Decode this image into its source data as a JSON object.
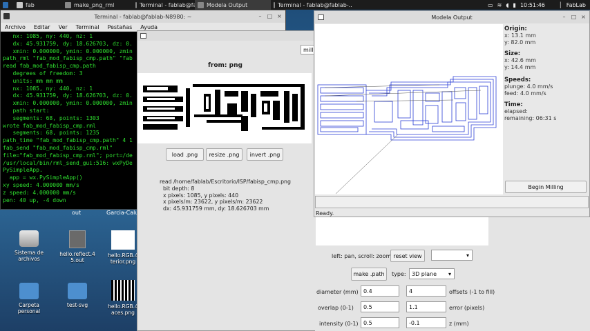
{
  "taskbar": {
    "tasks": [
      "fab",
      "make_png_rml",
      "Terminal - fablab@fabl...",
      "Modela Output",
      "Terminal - fablab@fablab-..."
    ],
    "time": "10:51:46",
    "user": "FabLab"
  },
  "terminal": {
    "title": "Terminal - fablab@fablab-N8980: ~",
    "menu": [
      "Archivo",
      "Editar",
      "Ver",
      "Terminal",
      "Pestañas",
      "Ayuda"
    ],
    "lines": [
      "   nx: 1085, ny: 440, nz: 1",
      "   dx: 45.931759, dy: 18.626703, dz: 0.",
      "   xmin: 0.000000, ymin: 0.000000, zmin",
      "path_rml \"fab_mod_fabisp_cmp.path\" \"fab",
      "read fab_mod_fabisp_cmp.path",
      "   degrees of freedom: 3",
      "   units: mm mm mm",
      "   nx: 1085, ny: 440, nz: 1",
      "   dx: 45.931759, dy: 18.626703, dz: 0.",
      "   xmin: 0.000000, ymin: 0.000000, zmin",
      "   path start:",
      "   segments: 68, points: 1303",
      "wrote fab_mod_fabisp_cmp.rml",
      "   segments: 68, points: 1235",
      "path_time \"fab_mod_fabisp_cmp.path\" 4 1",
      "fab_send \"fab_mod_fabisp_cmp.rml\"",
      "file=\"fab_mod_fabisp_cmp.rml\"; port=/de",
      "/usr/local/bin/rml_send_gui:516: wxPyDe",
      "PySimpleApp.",
      "  app = wx.PySimpleApp()",
      "xy speed: 4.000000 mm/s",
      "z speed: 4.000000 mm/s",
      "pen: 40 up, -4 down"
    ]
  },
  "desktop": {
    "icons": [
      {
        "label": "Sistema de archivos"
      },
      {
        "label": "hello.reflect.4 5.out"
      },
      {
        "label": "hello.RGB.4 terior.png"
      },
      {
        "label": "Carpeta personal"
      },
      {
        "label": "test-svg"
      },
      {
        "label": "hello.RGB.4 aces.png"
      }
    ],
    "partial_labels": [
      "out",
      "Garcia-Calu"
    ]
  },
  "rml": {
    "from_label": "from: png",
    "mill_partial": "mill t",
    "buttons": {
      "load": "load .png",
      "resize": "resize .png",
      "invert": "invert .png"
    },
    "info": [
      "read /home/fablab/Escritorio/ISP/fabisp_cmp.png",
      "  bit depth: 8",
      "  x pixels: 1085, y pixels: 440",
      "  x pixels/m: 23622, y pixels/m: 23622",
      "  dx: 45.931759 mm, dy: 18.626703 mm"
    ],
    "pan_hint": "left: pan, scroll: zoom",
    "reset_view": "reset view",
    "make_path": "make .path",
    "type_label": "type:",
    "type_value": "3D plane",
    "diameter_label": "diameter (mm)",
    "diameter_value": "0.4",
    "offsets_value": "4",
    "offsets_label": "offsets (-1 to fill)",
    "overlap_label": "overlap (0-1)",
    "overlap_value": "0.5",
    "error_value": "1.1",
    "error_label": "error (pixels)",
    "intensity_label": "intensity (0-1)",
    "intensity_value": "0.5",
    "z_value": "-0.1",
    "z_label": "z (mm)"
  },
  "modela": {
    "title": "Modela Output",
    "origin_title": "Origin:",
    "origin_x": "x: 13.1 mm",
    "origin_y": "y: 82.0 mm",
    "size_title": "Size:",
    "size_x": "x: 42.6 mm",
    "size_y": "y: 14.4 mm",
    "speeds_title": "Speeds:",
    "plunge": "plunge: 4.0 mm/s",
    "feed": "feed: 4.0 mm/s",
    "time_title": "Time:",
    "elapsed": "elapsed:",
    "remaining": "remaining: 06:31 s",
    "begin": "Begin Milling",
    "status": "Ready."
  },
  "colors": {
    "terminal_text": "#2fe02f",
    "toolpath": "#2b3fd6",
    "desktop": "#1f4e7a"
  }
}
